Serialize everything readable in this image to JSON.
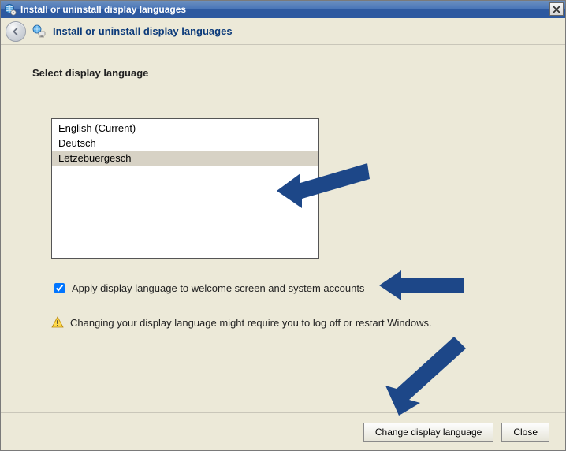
{
  "window": {
    "title": "Install or uninstall display languages"
  },
  "header": {
    "title": "Install or uninstall display languages"
  },
  "content": {
    "section_title": "Select display language",
    "languages": [
      {
        "label": "English (Current)",
        "selected": false
      },
      {
        "label": "Deutsch",
        "selected": false
      },
      {
        "label": "Lëtzebuergesch",
        "selected": true
      }
    ],
    "checkbox": {
      "checked": true,
      "label": "Apply display language to welcome screen and system accounts"
    },
    "warning": "Changing your display language might require you to log off or restart Windows."
  },
  "footer": {
    "primary_label": "Change display language",
    "close_label": "Close"
  }
}
